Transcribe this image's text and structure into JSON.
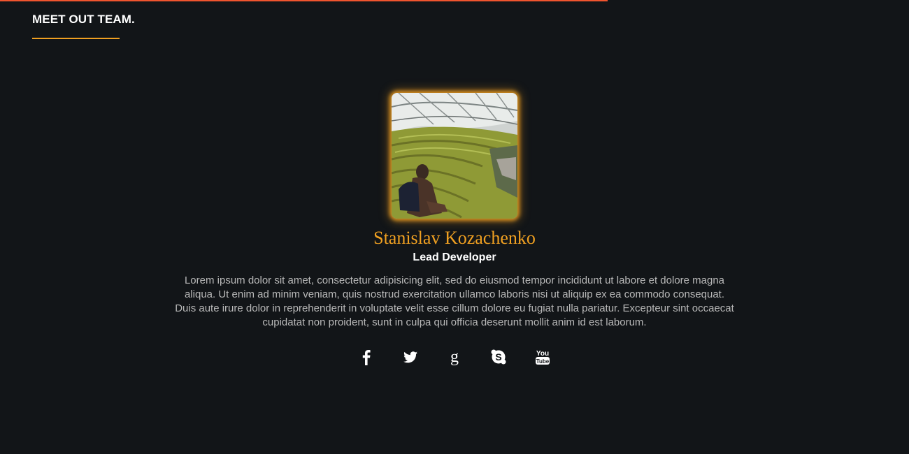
{
  "section": {
    "title": "MEET OUT TEAM."
  },
  "colors": {
    "accent": "#f0a021",
    "progress": "#f0542e",
    "background": "#121518"
  },
  "member": {
    "name": "Stanislav Kozachenko",
    "role": "Lead Developer",
    "bio": "Lorem ipsum dolor sit amet, consectetur adipisicing elit, sed do eiusmod tempor incididunt ut labore et dolore magna aliqua. Ut enim ad minim veniam, quis nostrud exercitation ullamco laboris nisi ut aliquip ex ea commodo consequat. Duis aute irure dolor in reprehenderit in voluptate velit esse cillum dolore eu fugiat nulla pariatur. Excepteur sint occaecat cupidatat non proident, sunt in culpa qui officia deserunt mollit anim id est laborum.",
    "photo_icon": "stadium-photo"
  },
  "social": [
    {
      "icon": "facebook-icon"
    },
    {
      "icon": "twitter-icon"
    },
    {
      "icon": "google-plus-icon"
    },
    {
      "icon": "skype-icon"
    },
    {
      "icon": "youtube-icon"
    }
  ]
}
